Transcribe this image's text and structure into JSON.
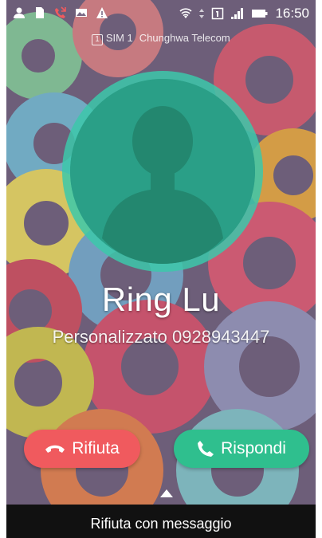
{
  "status_bar": {
    "time": "16:50"
  },
  "carrier": {
    "sim_index": "1",
    "sim_label": "SIM 1",
    "operator": "Chunghwa Telecom"
  },
  "caller": {
    "name": "Ring Lu",
    "number_line": "Personalizzato 0928943447"
  },
  "actions": {
    "reject_label": "Rifiuta",
    "answer_label": "Rispondi"
  },
  "bottom": {
    "reject_with_message": "Rifiuta con messaggio"
  },
  "colors": {
    "avatar_ring": "#3cc8aa",
    "avatar_fill": "#2a9f87",
    "reject": "#f05a5e",
    "answer": "#2fbf8e"
  }
}
